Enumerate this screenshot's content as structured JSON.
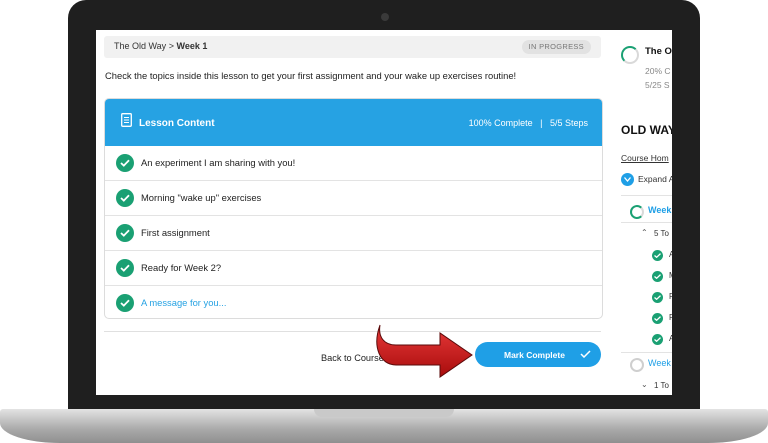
{
  "breadcrumb": {
    "course": "The Old Way",
    "separator": ">",
    "current": "Week 1"
  },
  "status_badge": "IN PROGRESS",
  "intro_text": "Check the topics inside this lesson to get your first assignment and your wake up exercises routine!",
  "lesson": {
    "title": "Lesson Content",
    "progress": "100% Complete",
    "steps": "5/5 Steps",
    "items": [
      {
        "label": "An experiment I am sharing with you!",
        "completed": true
      },
      {
        "label": "Morning \"wake up\" exercises",
        "completed": true
      },
      {
        "label": "First assignment",
        "completed": true
      },
      {
        "label": "Ready for Week 2?",
        "completed": true
      },
      {
        "label": "A message for you...",
        "completed": true,
        "active": true
      }
    ]
  },
  "footer": {
    "back_label": "Back to Course",
    "mark_complete_label": "Mark Complete"
  },
  "sidebar": {
    "course_title": "The O",
    "percent_complete": "20% C",
    "steps_complete": "5/25 S",
    "heading": "OLD WAY",
    "course_home": "Course Hom",
    "expand_all": "Expand A",
    "weeks": [
      {
        "label": "Week",
        "expanded": true,
        "topics": "5 To",
        "items": [
          "A",
          "M",
          "F",
          "R",
          "A"
        ]
      },
      {
        "label": "Week",
        "expanded": false,
        "topics": "1 To"
      }
    ]
  },
  "colors": {
    "accent": "#26a2e3",
    "button": "#1f9fe6",
    "check": "#1aa073",
    "arrow": "#d41a1a"
  }
}
